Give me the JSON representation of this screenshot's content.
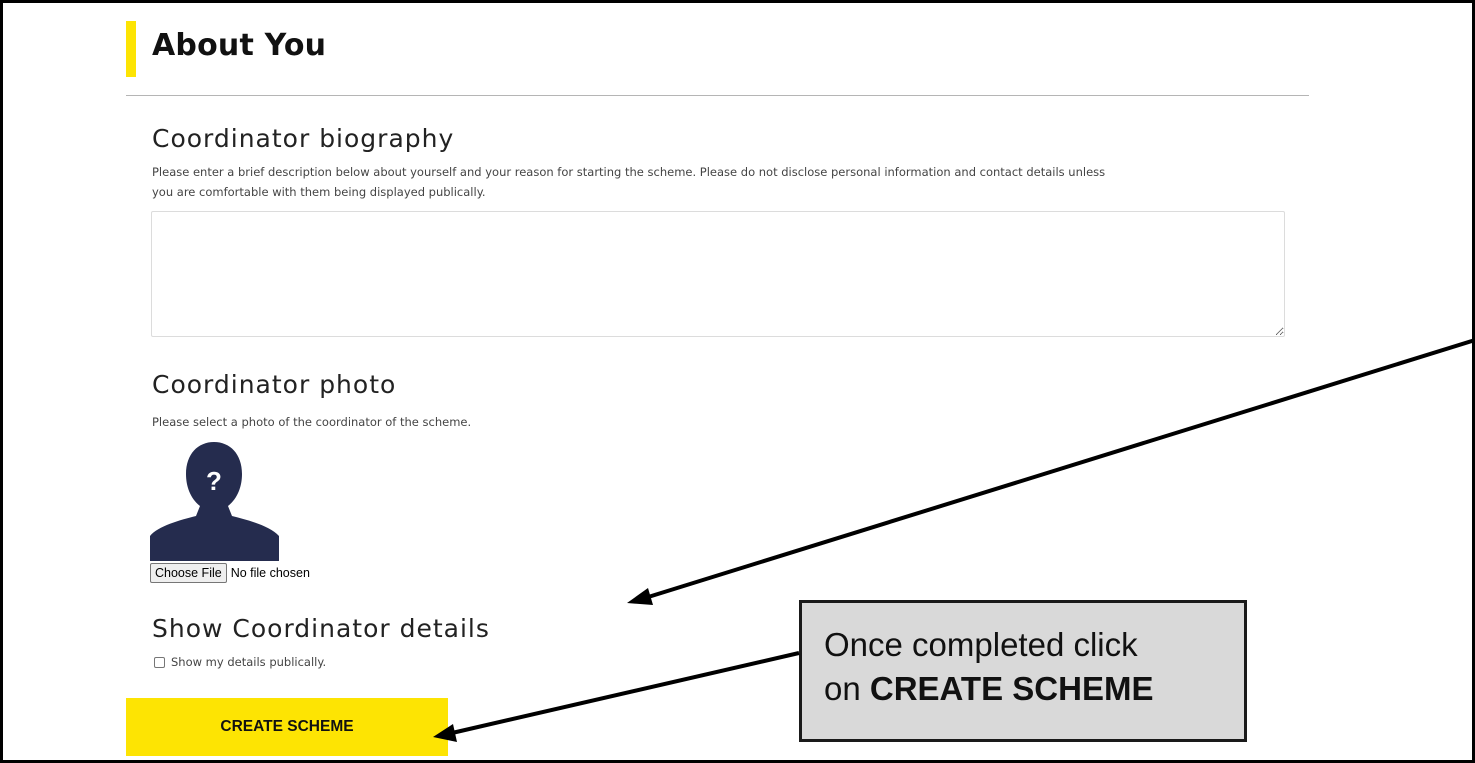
{
  "section": {
    "title": "About You"
  },
  "biography": {
    "heading": "Coordinator biography",
    "help_line1": "Please enter a brief description below about yourself and your reason for starting the scheme. Please do not disclose personal information and contact details unless",
    "help_line2": "you are comfortable with them being displayed publically.",
    "value": "",
    "placeholder": ""
  },
  "photo": {
    "heading": "Coordinator photo",
    "help": "Please select a photo of the coordinator of the scheme.",
    "placeholder_glyph": "?",
    "choose_button_label": "Choose File",
    "file_status": "No file chosen",
    "icon": "unknown-person-silhouette"
  },
  "details": {
    "heading": "Show Coordinator details",
    "checkbox_label": "Show my details publically.",
    "checked": false
  },
  "submit": {
    "label": "CREATE SCHEME"
  },
  "callout": {
    "line1": "Once completed click",
    "line2_prefix": "on ",
    "line2_bold": "CREATE SCHEME"
  },
  "colors": {
    "accent": "#fde403",
    "silhouette": "#252c4e",
    "callout_bg": "#d9d9d9"
  }
}
